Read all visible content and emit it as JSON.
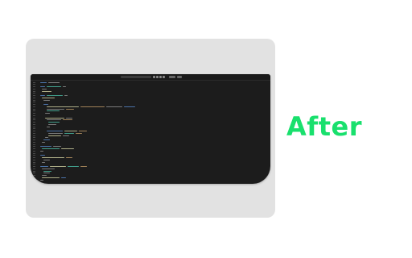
{
  "label": "After",
  "colors": {
    "label": "#19e06d",
    "card": "#e2e2e2",
    "editor_bg": "#1c1c1c",
    "token_default": "#9a9a9a",
    "token_keyword": "#5b8fd6",
    "token_string": "#c9a26b",
    "token_type": "#4ec9b0",
    "token_function": "#dcdcaa"
  },
  "icons": [
    "search-icon",
    "sync-icon",
    "branch-icon",
    "settings-icon",
    "layout-icon"
  ]
}
